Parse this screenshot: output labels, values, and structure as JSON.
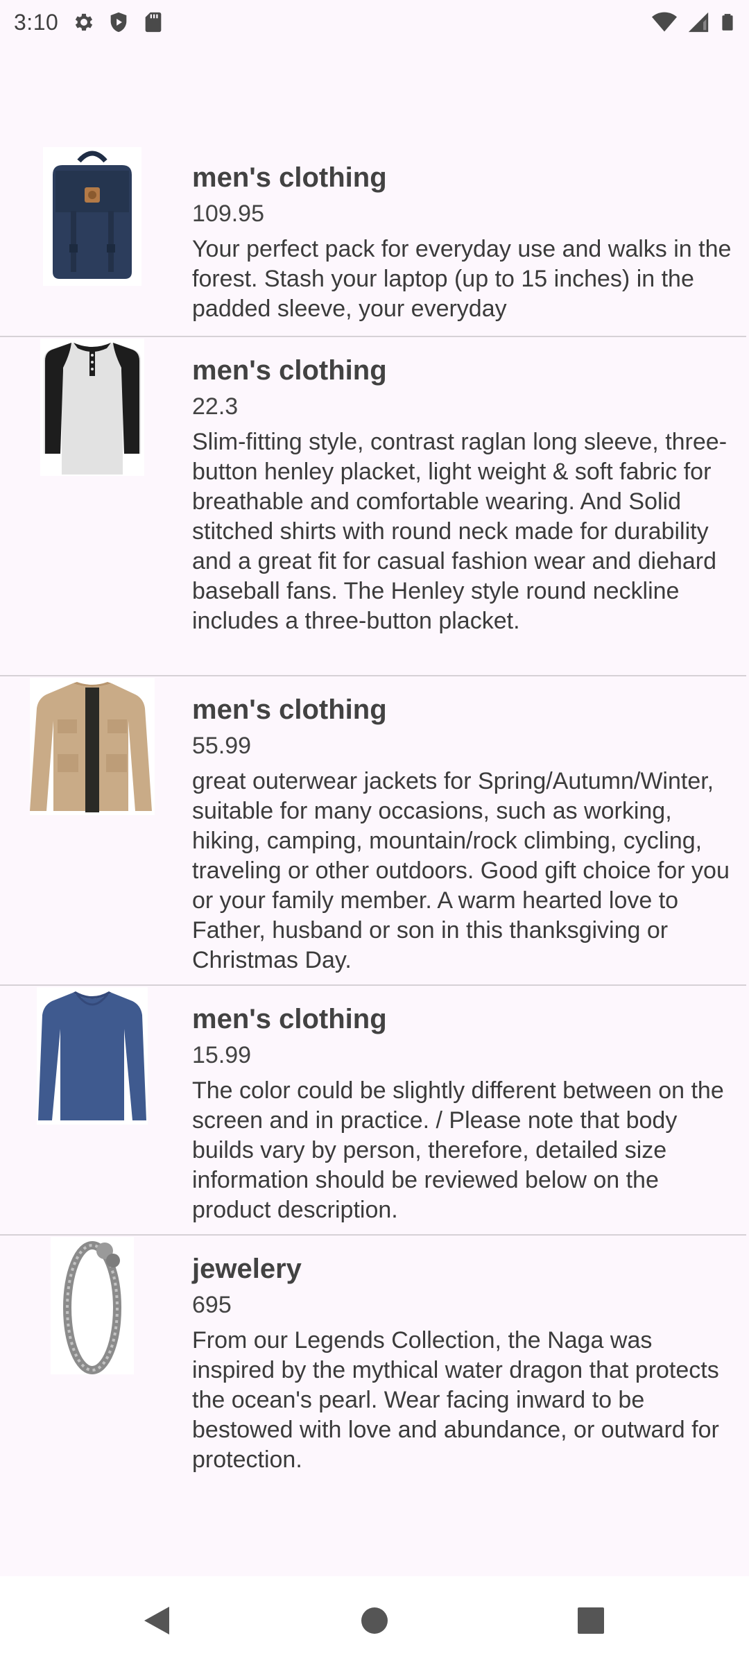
{
  "status_bar": {
    "time": "3:10",
    "icons": [
      "gear-icon",
      "shield-play-icon",
      "sd-card-icon"
    ],
    "right_icons": [
      "wifi-icon",
      "signal-icon",
      "battery-icon"
    ]
  },
  "products": [
    {
      "category": "men's clothing",
      "price": "109.95",
      "description": "Your perfect pack for everyday use and walks in the forest. Stash your laptop (up to 15 inches) in the padded sleeve, your everyday",
      "image": "backpack"
    },
    {
      "category": "men's clothing",
      "price": "22.3",
      "description": "Slim-fitting style, contrast raglan long sleeve, three-button henley placket, light weight & soft fabric for breathable and comfortable wearing. And Solid stitched shirts with round neck made for durability and a great fit for casual fashion wear and diehard baseball fans. The Henley style round neckline includes a three-button placket.",
      "image": "henley-shirt"
    },
    {
      "category": "men's clothing",
      "price": "55.99",
      "description": "great outerwear jackets for Spring/Autumn/Winter, suitable for many occasions, such as working, hiking, camping, mountain/rock climbing, cycling, traveling or other outdoors. Good gift choice for you or your family member. A warm hearted love to Father, husband or son in this thanksgiving or Christmas Day.",
      "image": "jacket"
    },
    {
      "category": "men's clothing",
      "price": "15.99",
      "description": "The color could be slightly different between on the screen and in practice. / Please note that body builds vary by person, therefore, detailed size information should be reviewed below on the product description.",
      "image": "long-sleeve-tee"
    },
    {
      "category": "jewelery",
      "price": "695",
      "description": "From our Legends Collection, the Naga was inspired by the mythical water dragon that protects the ocean's pearl. Wear facing inward to be bestowed with love and abundance, or outward for protection.",
      "image": "bracelet"
    }
  ],
  "nav_bar": {
    "buttons": [
      "back-icon",
      "home-icon",
      "recents-icon"
    ]
  },
  "colors": {
    "background": "#fdf7fd",
    "divider": "#d6d1d6",
    "text": "#3a3a3a"
  }
}
